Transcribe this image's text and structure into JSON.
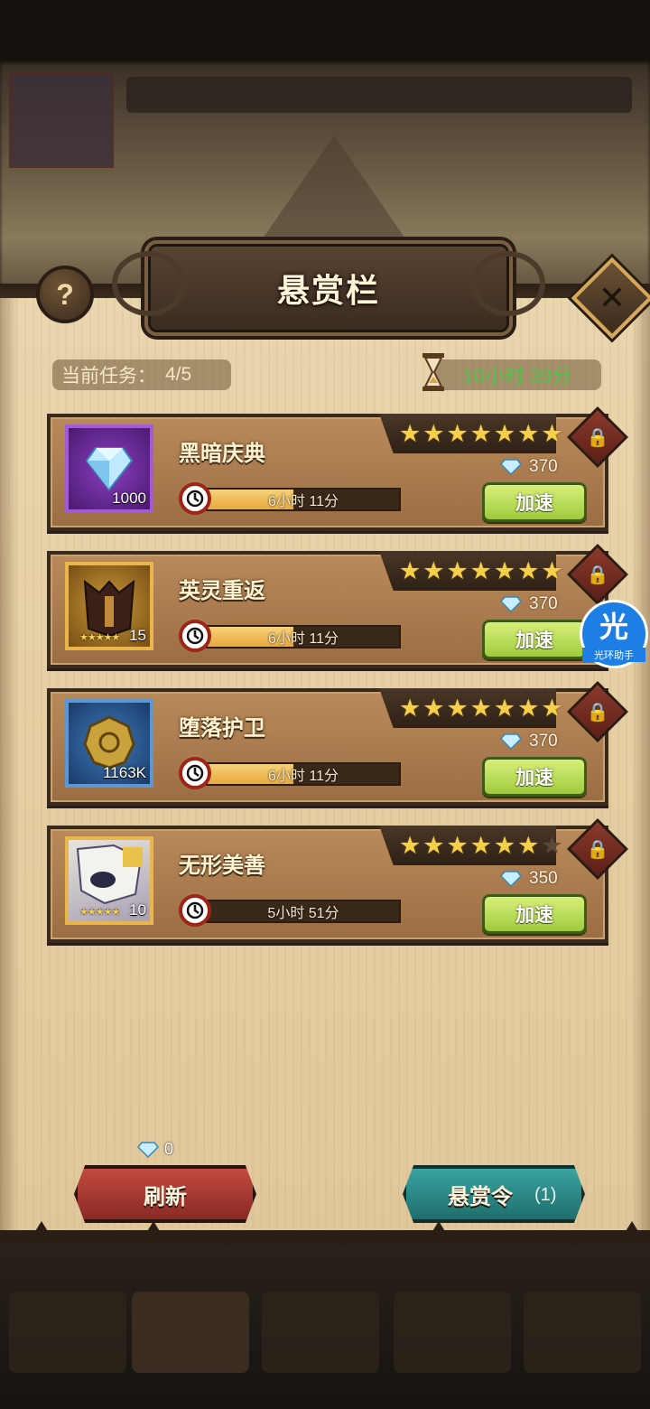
{
  "header": {
    "title": "悬赏栏",
    "help_label": "?",
    "close_label": "✕"
  },
  "info": {
    "current_task_label": "当前任务：",
    "current_task_value": "4/5",
    "remaining_time": "10小时 39分"
  },
  "bounties": [
    {
      "name": "黑暗庆典",
      "reward_icon": "diamond-icon",
      "reward_count": "1000",
      "reward_stars": "",
      "stars_filled": 7,
      "stars_total": 7,
      "cost": "370",
      "timer_text": "6小时 11分",
      "progress": 0.45,
      "speed_label": "加速"
    },
    {
      "name": "英灵重返",
      "reward_icon": "hero-armor-icon",
      "reward_count": "15",
      "reward_stars": "★★★★★",
      "stars_filled": 7,
      "stars_total": 7,
      "cost": "370",
      "timer_text": "6小时 11分",
      "progress": 0.45,
      "speed_label": "加速"
    },
    {
      "name": "堕落护卫",
      "reward_icon": "gold-coin-icon",
      "reward_count": "1163K",
      "reward_stars": "",
      "stars_filled": 7,
      "stars_total": 7,
      "cost": "370",
      "timer_text": "6小时 11分",
      "progress": 0.45,
      "speed_label": "加速"
    },
    {
      "name": "无形美善",
      "reward_icon": "hero-portrait-icon",
      "reward_count": "10",
      "reward_stars": "★★★★★",
      "stars_filled": 6,
      "stars_total": 7,
      "cost": "350",
      "timer_text": "5小时 51分",
      "progress": 0.0,
      "speed_label": "加速"
    }
  ],
  "footer": {
    "refresh_cost": "0",
    "refresh_label": "刷新",
    "bounty_order_label": "悬赏令",
    "bounty_order_count": "(1)"
  },
  "overlay": {
    "assistant_big": "光",
    "assistant_small": "光环助手"
  },
  "colors": {
    "panel": "#e6cfa4",
    "card": "#a8794c",
    "speed_button": "#b5dc55",
    "refresh_button": "#a93a32",
    "order_button": "#2a8a87",
    "time_text": "#55c24a"
  }
}
